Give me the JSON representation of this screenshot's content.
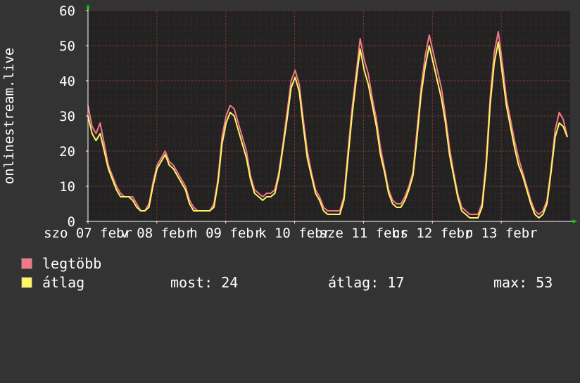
{
  "chart_data": {
    "type": "line",
    "ylabel": "onlinestream.live",
    "ylim": [
      0,
      60
    ],
    "yticks": [
      0,
      10,
      20,
      30,
      40,
      50,
      60
    ],
    "x_tick_labels": [
      "szo 07 febr",
      "v 08 febr",
      "h 09 febr",
      "k 10 febr",
      "sze 11 febr",
      "cs 12 febr",
      "p 13 febr"
    ],
    "grid": true,
    "legend_position": "bottom-left",
    "series": [
      {
        "name": "legtöbb",
        "color": "#f27a86",
        "values": [
          33,
          27,
          25,
          28,
          22,
          16,
          13,
          10,
          8,
          7,
          7,
          7,
          5,
          3,
          3,
          5,
          11,
          16,
          18,
          20,
          17,
          16,
          14,
          12,
          10,
          6,
          4,
          3,
          3,
          3,
          3,
          5,
          12,
          24,
          30,
          33,
          32,
          28,
          24,
          20,
          13,
          9,
          8,
          7,
          8,
          8,
          9,
          14,
          22,
          31,
          40,
          43,
          39,
          29,
          20,
          14,
          9,
          7,
          4,
          3,
          3,
          3,
          3,
          7,
          20,
          32,
          42,
          52,
          46,
          42,
          35,
          29,
          21,
          15,
          9,
          6,
          5,
          5,
          7,
          10,
          14,
          26,
          38,
          47,
          53,
          48,
          43,
          38,
          30,
          21,
          14,
          8,
          4,
          3,
          2,
          2,
          2,
          5,
          17,
          35,
          48,
          54,
          45,
          35,
          29,
          23,
          18,
          14,
          10,
          6,
          3,
          2,
          3,
          6,
          15,
          26,
          31,
          29,
          24
        ]
      },
      {
        "name": "átlag",
        "color": "#fff467",
        "values": [
          30,
          25,
          23,
          25,
          20,
          15,
          12,
          9,
          7,
          7,
          7,
          6,
          4,
          3,
          3,
          4,
          10,
          15,
          17,
          19,
          16,
          15,
          13,
          11,
          9,
          5,
          3,
          3,
          3,
          3,
          3,
          4,
          11,
          22,
          28,
          31,
          30,
          26,
          22,
          18,
          12,
          8,
          7,
          6,
          7,
          7,
          8,
          13,
          21,
          29,
          38,
          41,
          37,
          27,
          18,
          13,
          8,
          6,
          3,
          2,
          2,
          2,
          2,
          6,
          18,
          30,
          40,
          49,
          43,
          39,
          33,
          27,
          19,
          14,
          8,
          5,
          4,
          4,
          6,
          9,
          13,
          24,
          36,
          44,
          50,
          45,
          40,
          35,
          28,
          19,
          13,
          7,
          3,
          2,
          1,
          1,
          1,
          4,
          15,
          33,
          45,
          51,
          42,
          33,
          27,
          21,
          16,
          13,
          9,
          5,
          2,
          1,
          2,
          5,
          14,
          24,
          28,
          27,
          24
        ]
      }
    ]
  },
  "legend": {
    "max_label": "legtöbb",
    "avg_label": "átlag",
    "stat_now": "most: 24",
    "stat_avg": "átlag: 17",
    "stat_max": "max: 53"
  }
}
